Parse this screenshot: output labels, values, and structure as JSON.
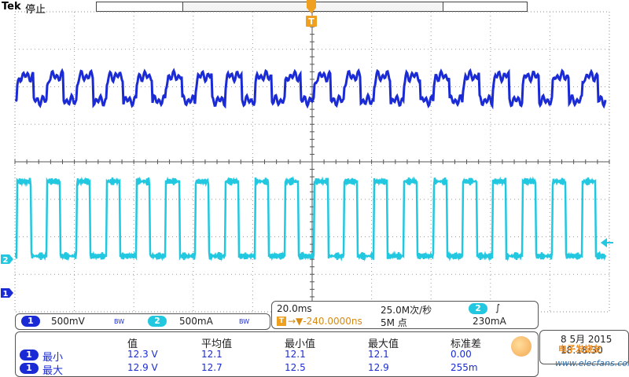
{
  "header": {
    "brand": "Tek",
    "run_state": "停止",
    "trigger_marker_label": "T"
  },
  "channels": {
    "ch1": {
      "number": "1",
      "scale": "500mV",
      "bw": "BW",
      "color": "#1a2bd6"
    },
    "ch2": {
      "number": "2",
      "scale": "500mA",
      "bw": "BW",
      "color": "#22c8e0"
    }
  },
  "timebase": {
    "time_per_div": "20.0ms",
    "sample_rate": "25.0M次/秒",
    "trigger_position": "→▼-240.0000ns",
    "record_length": "5M 点",
    "trigger_source": "2",
    "trigger_slope": "∫",
    "trigger_level": "230mA"
  },
  "measurements": {
    "headers": [
      "值",
      "平均值",
      "最小值",
      "最大值",
      "标准差"
    ],
    "rows": [
      {
        "channel": "1",
        "name": "最小",
        "values": [
          "12.3 V",
          "12.1",
          "12.1",
          "12.1",
          "0.00"
        ]
      },
      {
        "channel": "1",
        "name": "最大",
        "values": [
          "12.9 V",
          "12.7",
          "12.5",
          "12.9",
          "255m"
        ]
      }
    ]
  },
  "datetime": {
    "date": "8 5月 2015",
    "time": "18:18:30"
  },
  "watermark": {
    "logo_text": "电子发烧友",
    "site": "www.elecfans.com"
  }
}
